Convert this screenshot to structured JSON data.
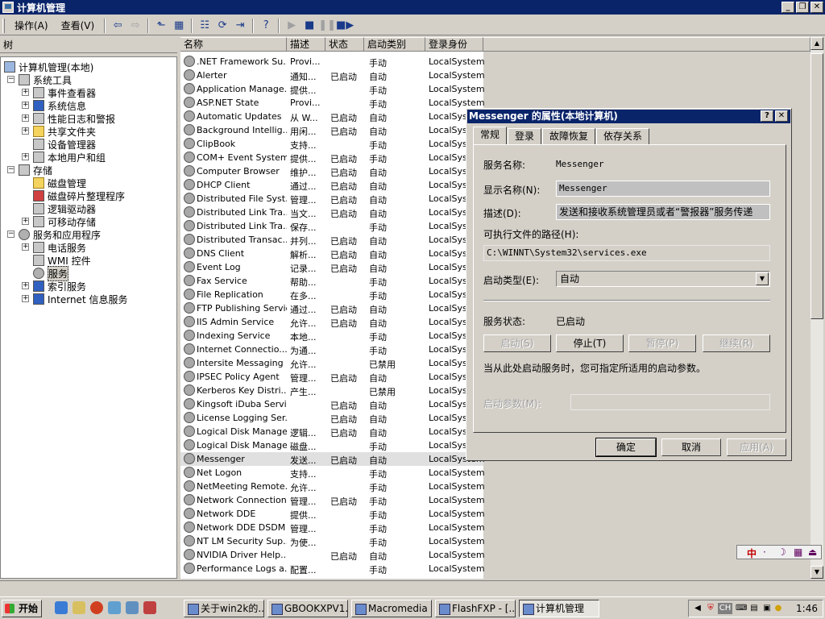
{
  "window": {
    "title": "计算机管理"
  },
  "menubar": {
    "items": [
      "操作(A)",
      "查看(V)"
    ]
  },
  "tree": {
    "header": "树",
    "nodes": [
      {
        "label": "计算机管理(本地)",
        "level": 0,
        "icon": "computer-icon"
      },
      {
        "label": "系统工具",
        "level": 1,
        "icon": "tools-icon"
      },
      {
        "label": "事件查看器",
        "level": 2,
        "icon": "event-viewer-icon"
      },
      {
        "label": "系统信息",
        "level": 2,
        "icon": "system-info-icon"
      },
      {
        "label": "性能日志和警报",
        "level": 2,
        "icon": "performance-icon"
      },
      {
        "label": "共享文件夹",
        "level": 2,
        "icon": "shared-folder-icon"
      },
      {
        "label": "设备管理器",
        "level": 2,
        "icon": "device-manager-icon"
      },
      {
        "label": "本地用户和组",
        "level": 2,
        "icon": "users-icon"
      },
      {
        "label": "存储",
        "level": 1,
        "icon": "storage-icon"
      },
      {
        "label": "磁盘管理",
        "level": 2,
        "icon": "disk-icon"
      },
      {
        "label": "磁盘碎片整理程序",
        "level": 2,
        "icon": "defrag-icon"
      },
      {
        "label": "逻辑驱动器",
        "level": 2,
        "icon": "drive-icon"
      },
      {
        "label": "可移动存储",
        "level": 2,
        "icon": "removable-storage-icon"
      },
      {
        "label": "服务和应用程序",
        "level": 1,
        "icon": "services-apps-icon"
      },
      {
        "label": "电话服务",
        "level": 2,
        "icon": "telephony-icon"
      },
      {
        "label": "WMI 控件",
        "level": 2,
        "icon": "wmi-icon"
      },
      {
        "label": "服务",
        "level": 2,
        "icon": "services-gear-icon"
      },
      {
        "label": "索引服务",
        "level": 2,
        "icon": "index-icon"
      },
      {
        "label": "Internet 信息服务",
        "level": 2,
        "icon": "iis-icon"
      }
    ]
  },
  "list": {
    "columns": [
      "名称",
      "描述",
      "状态",
      "启动类别",
      "登录身份"
    ],
    "rows": [
      [
        ".NET Framework Su...",
        "Provi...",
        "",
        "手动",
        "LocalSystem"
      ],
      [
        "Alerter",
        "通知...",
        "已启动",
        "自动",
        "LocalSystem"
      ],
      [
        "Application Manage...",
        "提供...",
        "",
        "手动",
        "LocalSystem"
      ],
      [
        "ASP.NET State",
        "Provi...",
        "",
        "手动",
        "LocalSystem"
      ],
      [
        "Automatic Updates",
        "从 W...",
        "已启动",
        "自动",
        "LocalSystem"
      ],
      [
        "Background Intellig...",
        "用闲...",
        "已启动",
        "自动",
        "LocalSystem"
      ],
      [
        "ClipBook",
        "支持...",
        "",
        "手动",
        "LocalSystem"
      ],
      [
        "COM+ Event System",
        "提供...",
        "已启动",
        "手动",
        "LocalSystem"
      ],
      [
        "Computer Browser",
        "维护...",
        "已启动",
        "自动",
        "LocalSystem"
      ],
      [
        "DHCP Client",
        "通过...",
        "已启动",
        "自动",
        "LocalSystem"
      ],
      [
        "Distributed File Syst...",
        "管理...",
        "已启动",
        "自动",
        "LocalSystem"
      ],
      [
        "Distributed Link Tra...",
        "当文...",
        "已启动",
        "自动",
        "LocalSystem"
      ],
      [
        "Distributed Link Tra...",
        "保存...",
        "",
        "手动",
        "LocalSystem"
      ],
      [
        "Distributed Transac...",
        "并列...",
        "已启动",
        "自动",
        "LocalSystem"
      ],
      [
        "DNS Client",
        "解析...",
        "已启动",
        "自动",
        "LocalSystem"
      ],
      [
        "Event Log",
        "记录...",
        "已启动",
        "自动",
        "LocalSystem"
      ],
      [
        "Fax Service",
        "帮助...",
        "",
        "手动",
        "LocalSystem"
      ],
      [
        "File Replication",
        "在多...",
        "",
        "手动",
        "LocalSystem"
      ],
      [
        "FTP Publishing Service",
        "通过...",
        "已启动",
        "自动",
        "LocalSystem"
      ],
      [
        "IIS Admin Service",
        "允许...",
        "已启动",
        "自动",
        "LocalSystem"
      ],
      [
        "Indexing Service",
        "本地...",
        "",
        "手动",
        "LocalSystem"
      ],
      [
        "Internet Connectio...",
        "为通...",
        "",
        "手动",
        "LocalSystem"
      ],
      [
        "Intersite Messaging",
        "允许...",
        "",
        "已禁用",
        "LocalSystem"
      ],
      [
        "IPSEC Policy Agent",
        "管理...",
        "已启动",
        "自动",
        "LocalSystem"
      ],
      [
        "Kerberos Key Distri...",
        "产生...",
        "",
        "已禁用",
        "LocalSystem"
      ],
      [
        "Kingsoft iDuba Service",
        "",
        "已启动",
        "自动",
        "LocalSystem"
      ],
      [
        "License Logging Ser...",
        "",
        "已启动",
        "自动",
        "LocalSystem"
      ],
      [
        "Logical Disk Manager",
        "逻辑...",
        "已启动",
        "自动",
        "LocalSystem"
      ],
      [
        "Logical Disk Manage...",
        "磁盘...",
        "",
        "手动",
        "LocalSystem"
      ],
      [
        "Messenger",
        "发送...",
        "已启动",
        "自动",
        "LocalSystem"
      ],
      [
        "Net Logon",
        "支持...",
        "",
        "手动",
        "LocalSystem"
      ],
      [
        "NetMeeting Remote...",
        "允许...",
        "",
        "手动",
        "LocalSystem"
      ],
      [
        "Network Connections",
        "管理...",
        "已启动",
        "手动",
        "LocalSystem"
      ],
      [
        "Network DDE",
        "提供...",
        "",
        "手动",
        "LocalSystem"
      ],
      [
        "Network DDE DSDM",
        "管理...",
        "",
        "手动",
        "LocalSystem"
      ],
      [
        "NT LM Security Sup...",
        "为使...",
        "",
        "手动",
        "LocalSystem"
      ],
      [
        "NVIDIA Driver Help...",
        "",
        "已启动",
        "自动",
        "LocalSystem"
      ],
      [
        "Performance Logs a...",
        "配置...",
        "",
        "手动",
        "LocalSystem"
      ]
    ]
  },
  "dialog": {
    "title": "Messenger 的属性(本地计算机)",
    "tabs": [
      "常规",
      "登录",
      "故障恢复",
      "依存关系"
    ],
    "service_name_label": "服务名称:",
    "service_name": "Messenger",
    "display_name_label": "显示名称(N):",
    "display_name": "Messenger",
    "description_label": "描述(D):",
    "description": "发送和接收系统管理员或者“警报器”服务传递",
    "exe_path_label": "可执行文件的路径(H):",
    "exe_path": "C:\\WINNT\\System32\\services.exe",
    "startup_type_label": "启动类型(E):",
    "startup_type": "自动",
    "status_label": "服务状态:",
    "status": "已启动",
    "btn_start": "启动(S)",
    "btn_stop": "停止(T)",
    "btn_pause": "暂停(P)",
    "btn_resume": "继续(R)",
    "hint": "当从此处启动服务时，您可指定所适用的启动参数。",
    "params_label": "启动参数(M):",
    "ok": "确定",
    "cancel": "取消",
    "apply": "应用(A)"
  },
  "taskbar": {
    "start": "开始",
    "tasks": [
      "关于win2k的...",
      "GBOOKXPV1...",
      "Macromedia ...",
      "FlashFXP - [...",
      "计算机管理"
    ],
    "clock": "1:46",
    "lang": "CH"
  },
  "ime": {
    "label": "中"
  }
}
